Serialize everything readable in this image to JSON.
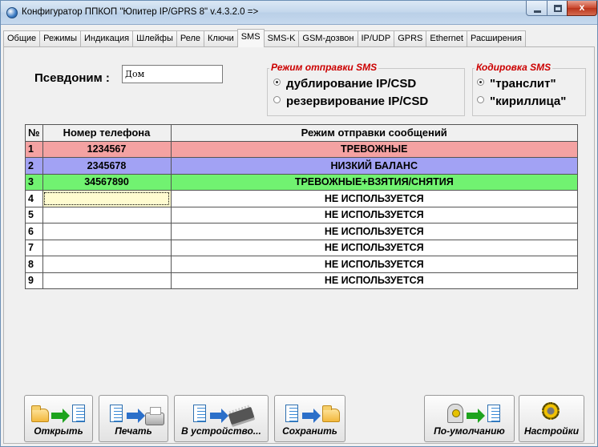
{
  "window": {
    "title": "Конфигуратор ППКОП \"Юпитер IP/GPRS 8\" v.4.3.2.0  =>",
    "controls": {
      "minimize": "–",
      "maximize": "□",
      "close": "x"
    }
  },
  "tabs": [
    "Общие",
    "Режимы",
    "Индикация",
    "Шлейфы",
    "Реле",
    "Ключи",
    "SMS",
    "SMS-K",
    "GSM-дозвон",
    "IP/UDP",
    "GPRS",
    "Ethernet",
    "Расширения"
  ],
  "active_tab": "SMS",
  "alias": {
    "label": "Псевдоним :",
    "value": "Дом"
  },
  "sms_mode": {
    "title": "Режим отправки SMS",
    "options": [
      "дублирование IP/CSD",
      "резервирование IP/CSD"
    ],
    "selected": 0
  },
  "sms_encoding": {
    "title": "Кодировка SMS",
    "options": [
      "\"транслит\"",
      "\"кириллица\""
    ],
    "selected": 0
  },
  "table": {
    "headers": [
      "№",
      "Номер телефона",
      "Режим отправки сообщений"
    ],
    "rows": [
      {
        "num": "1",
        "phone": "1234567",
        "mode": "ТРЕВОЖНЫЕ",
        "color": "#f4a2a2"
      },
      {
        "num": "2",
        "phone": "2345678",
        "mode": "НИЗКИЙ БАЛАНС",
        "color": "#a2a2f4"
      },
      {
        "num": "3",
        "phone": "34567890",
        "mode": "ТРЕВОЖНЫЕ+ВЗЯТИЯ/СНЯТИЯ",
        "color": "#71f271"
      },
      {
        "num": "4",
        "phone": "",
        "mode": "НЕ ИСПОЛЬЗУЕТСЯ"
      },
      {
        "num": "5",
        "phone": "",
        "mode": "НЕ ИСПОЛЬЗУЕТСЯ"
      },
      {
        "num": "6",
        "phone": "",
        "mode": "НЕ ИСПОЛЬЗУЕТСЯ"
      },
      {
        "num": "7",
        "phone": "",
        "mode": "НЕ ИСПОЛЬЗУЕТСЯ"
      },
      {
        "num": "8",
        "phone": "",
        "mode": "НЕ ИСПОЛЬЗУЕТСЯ"
      },
      {
        "num": "9",
        "phone": "",
        "mode": "НЕ ИСПОЛЬЗУЕТСЯ"
      }
    ]
  },
  "toolbar": {
    "open": "Открыть",
    "print": "Печать",
    "to_device": "В устройство...",
    "save": "Сохранить",
    "defaults": "По-умолчанию",
    "settings": "Настройки"
  },
  "icons": {
    "open": [
      "folder-icon",
      "arrow-right-icon",
      "document-icon"
    ],
    "print": [
      "document-icon",
      "arrow-right-icon",
      "printer-icon"
    ],
    "to_device": [
      "document-icon",
      "arrow-right-icon",
      "chip-icon"
    ],
    "save": [
      "document-icon",
      "arrow-right-icon",
      "folder-icon"
    ],
    "defaults": [
      "device-icon",
      "arrow-right-icon",
      "document-icon"
    ],
    "settings": [
      "gear-icon"
    ]
  }
}
